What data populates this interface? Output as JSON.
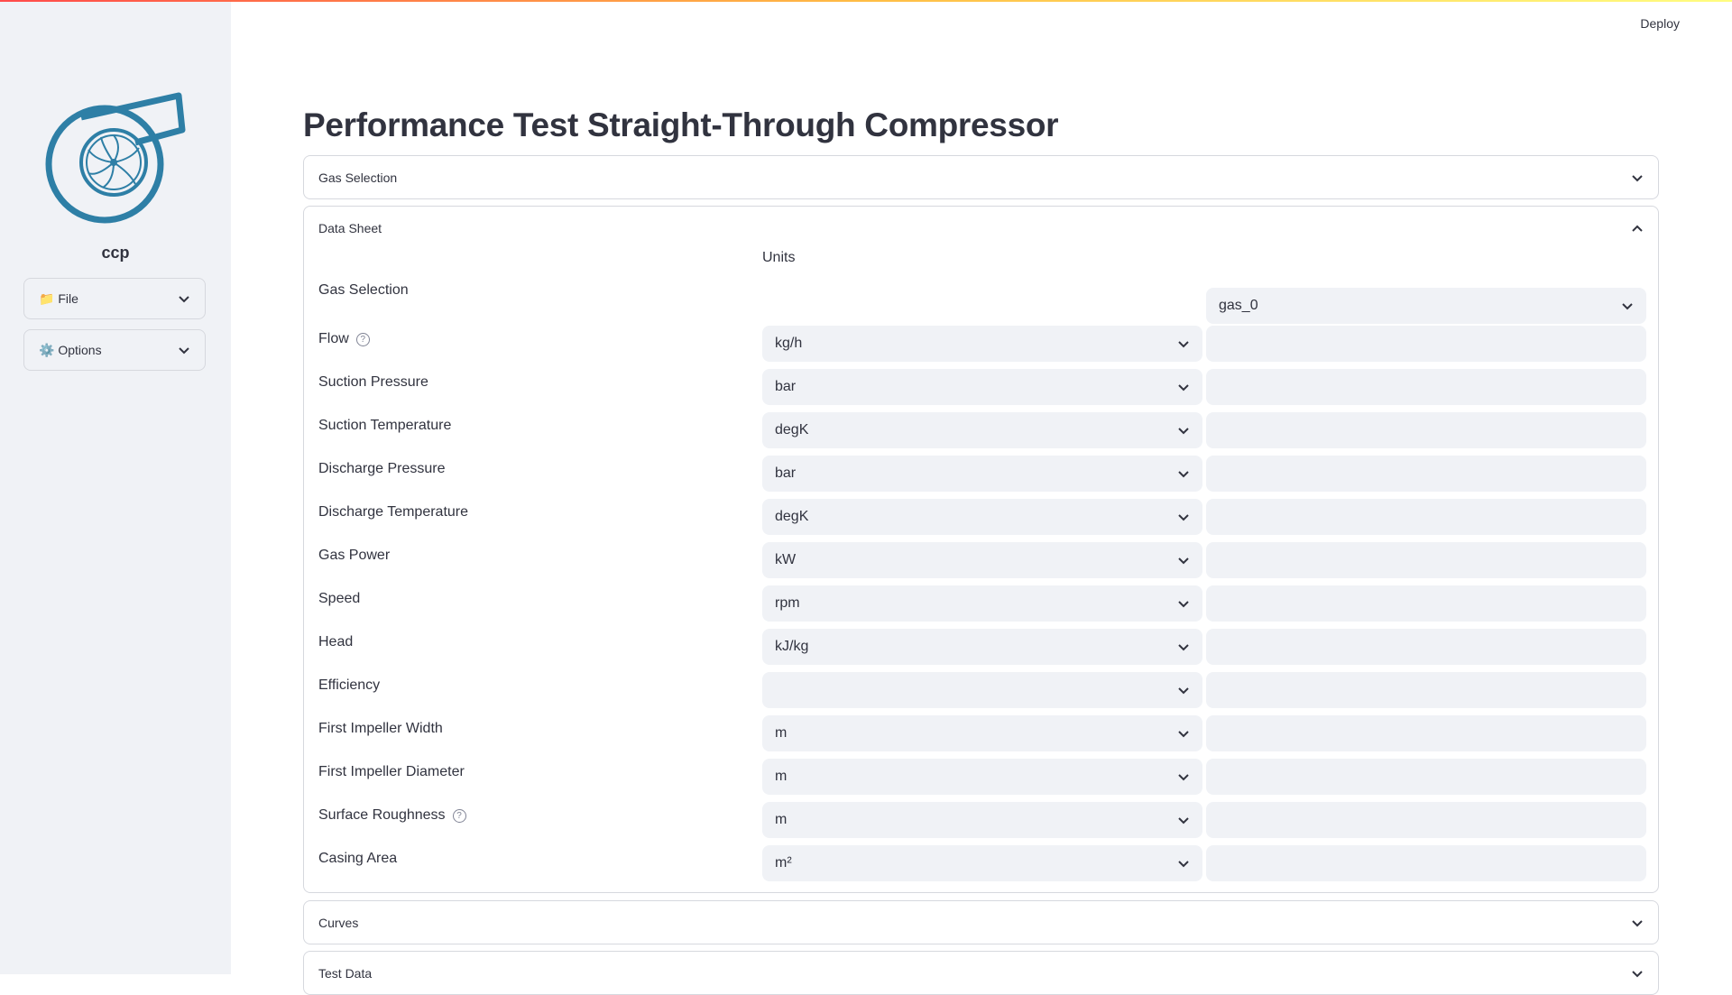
{
  "app": {
    "name": "ccp",
    "deploy_label": "Deploy",
    "accent_color": "#2e7fa6"
  },
  "sidebar": {
    "items": [
      {
        "label": "📁 File"
      },
      {
        "label": "⚙️ Options"
      }
    ]
  },
  "page": {
    "title": "Performance Test Straight-Through Compressor"
  },
  "expanders": {
    "gas_selection": {
      "label": "Gas Selection"
    },
    "data_sheet": {
      "label": "Data Sheet"
    },
    "curves": {
      "label": "Curves"
    },
    "test_data": {
      "label": "Test Data"
    }
  },
  "data_sheet": {
    "units_header": "Units",
    "gas_selection_label": "Gas Selection",
    "gas_selection_value": "gas_0",
    "rows": [
      {
        "label": "Flow",
        "unit": "kg/h",
        "value": "",
        "help": true
      },
      {
        "label": "Suction Pressure",
        "unit": "bar",
        "value": "",
        "help": false
      },
      {
        "label": "Suction Temperature",
        "unit": "degK",
        "value": "",
        "help": false
      },
      {
        "label": "Discharge Pressure",
        "unit": "bar",
        "value": "",
        "help": false
      },
      {
        "label": "Discharge Temperature",
        "unit": "degK",
        "value": "",
        "help": false
      },
      {
        "label": "Gas Power",
        "unit": "kW",
        "value": "",
        "help": false
      },
      {
        "label": "Speed",
        "unit": "rpm",
        "value": "",
        "help": false
      },
      {
        "label": "Head",
        "unit": "kJ/kg",
        "value": "",
        "help": false
      },
      {
        "label": "Efficiency",
        "unit": "",
        "value": "",
        "help": false
      },
      {
        "label": "First Impeller Width",
        "unit": "m",
        "value": "",
        "help": false
      },
      {
        "label": "First Impeller Diameter",
        "unit": "m",
        "value": "",
        "help": false
      },
      {
        "label": "Surface Roughness",
        "unit": "m",
        "value": "",
        "help": true
      },
      {
        "label": "Casing Area",
        "unit": "m²",
        "value": "",
        "help": false
      }
    ]
  },
  "icons": {
    "chevron_down": "chevron-down-icon",
    "chevron_up": "chevron-up-icon",
    "help": "help-icon",
    "logo": "compressor-logo-icon"
  }
}
